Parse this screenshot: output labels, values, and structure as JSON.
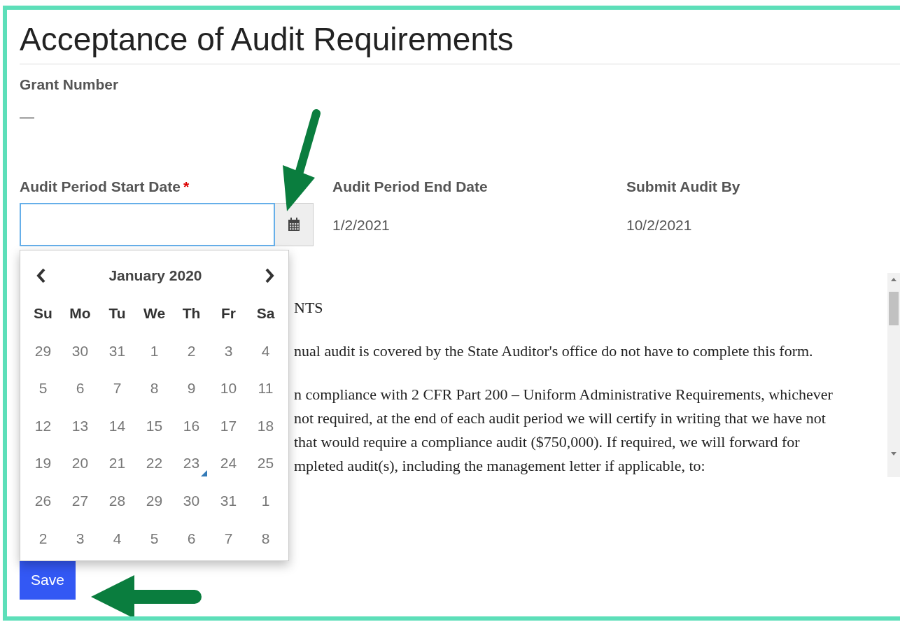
{
  "page_title": "Acceptance of Audit Requirements",
  "grant": {
    "label": "Grant Number",
    "value": "—"
  },
  "start_date": {
    "label": "Audit Period Start Date",
    "required_mark": "*",
    "focused": true
  },
  "end_date": {
    "label": "Audit Period End Date",
    "value": "1/2/2021"
  },
  "submit_by": {
    "label": "Submit Audit By",
    "value": "10/2/2021"
  },
  "datepicker": {
    "month_label": "January 2020",
    "weekdays": [
      "Su",
      "Mo",
      "Tu",
      "We",
      "Th",
      "Fr",
      "Sa"
    ],
    "weeks": [
      [
        {
          "day": "29",
          "today": false
        },
        {
          "day": "30",
          "today": false
        },
        {
          "day": "31",
          "today": false
        },
        {
          "day": "1",
          "today": false
        },
        {
          "day": "2",
          "today": false
        },
        {
          "day": "3",
          "today": false
        },
        {
          "day": "4",
          "today": false
        }
      ],
      [
        {
          "day": "5",
          "today": false
        },
        {
          "day": "6",
          "today": false
        },
        {
          "day": "7",
          "today": false
        },
        {
          "day": "8",
          "today": false
        },
        {
          "day": "9",
          "today": false
        },
        {
          "day": "10",
          "today": false
        },
        {
          "day": "11",
          "today": false
        }
      ],
      [
        {
          "day": "12",
          "today": false
        },
        {
          "day": "13",
          "today": false
        },
        {
          "day": "14",
          "today": false
        },
        {
          "day": "15",
          "today": false
        },
        {
          "day": "16",
          "today": false
        },
        {
          "day": "17",
          "today": false
        },
        {
          "day": "18",
          "today": false
        }
      ],
      [
        {
          "day": "19",
          "today": false
        },
        {
          "day": "20",
          "today": false
        },
        {
          "day": "21",
          "today": false
        },
        {
          "day": "22",
          "today": false
        },
        {
          "day": "23",
          "today": true
        },
        {
          "day": "24",
          "today": false
        },
        {
          "day": "25",
          "today": false
        }
      ],
      [
        {
          "day": "26",
          "today": false
        },
        {
          "day": "27",
          "today": false
        },
        {
          "day": "28",
          "today": false
        },
        {
          "day": "29",
          "today": false
        },
        {
          "day": "30",
          "today": false
        },
        {
          "day": "31",
          "today": false
        },
        {
          "day": "1",
          "today": false
        }
      ],
      [
        {
          "day": "2",
          "today": false
        },
        {
          "day": "3",
          "today": false
        },
        {
          "day": "4",
          "today": false
        },
        {
          "day": "5",
          "today": false
        },
        {
          "day": "6",
          "today": false
        },
        {
          "day": "7",
          "today": false
        },
        {
          "day": "8",
          "today": false
        }
      ]
    ]
  },
  "statement": {
    "paragraphs": [
      [
        "NTS"
      ],
      [
        "nual audit is covered by the State Auditor's office do not have to complete this form."
      ],
      [
        "n compliance with 2 CFR Part 200 – Uniform Administrative Requirements, whichever",
        "not required, at the end of each audit period we will certify in writing that we have not",
        "that would require a compliance audit ($750,000). If required, we will forward for",
        "mpleted audit(s), including the management letter if applicable, to:"
      ]
    ]
  },
  "save_button": "Save",
  "annotation_arrows": [
    {
      "kind": "down"
    },
    {
      "kind": "left"
    }
  ]
}
